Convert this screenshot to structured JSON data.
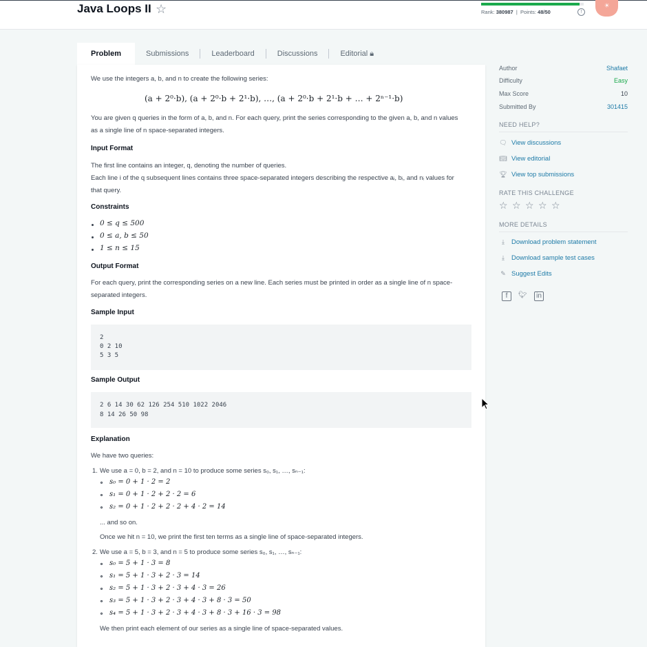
{
  "header": {
    "title": "Java Loops II",
    "rank_label": "Rank:",
    "rank_value": "380987",
    "points_label": "Points:",
    "points_value": "48/50",
    "progress": 0.96,
    "badge_text": "☀"
  },
  "tabs": [
    {
      "label": "Problem"
    },
    {
      "label": "Submissions"
    },
    {
      "label": "Leaderboard"
    },
    {
      "label": "Discussions"
    },
    {
      "label": "Editorial"
    }
  ],
  "problem": {
    "intro": "We use the integers a, b, and n to create the following series:",
    "series": "(a + 2⁰·b), (a + 2⁰·b + 2¹·b), …, (a + 2⁰·b + 2¹·b + … + 2ⁿ⁻¹·b)",
    "given_line1": "You are given q queries in the form of a, b, and n. For each query, print the series corresponding to the given a, b, and n values",
    "given_line2": "as a single line of n space-separated integers.",
    "input_format_heading": "Input Format",
    "input_line1": "The first line contains an integer, q, denoting the number of queries.",
    "input_line2": "Each line i of the q subsequent lines contains three space-separated integers describing the respective aᵢ, bᵢ, and nᵢ values for",
    "input_line3": "that query.",
    "constraints_heading": "Constraints",
    "constraints": [
      "0 ≤ q ≤ 500",
      "0 ≤ a, b ≤ 50",
      "1 ≤ n ≤ 15"
    ],
    "output_format_heading": "Output Format",
    "output_line1": "For each query, print the corresponding series on a new line. Each series must be printed in order as a single line of n space-",
    "output_line2": "separated integers.",
    "sample_input_heading": "Sample Input",
    "sample_input": [
      "2",
      "0 2 10",
      "5 3 5"
    ],
    "sample_output_heading": "Sample Output",
    "sample_output": [
      "2 6 14 30 62 126 254 510 1022 2046",
      "8 14 26 50 98"
    ],
    "explanation_heading": "Explanation",
    "explanation_intro": "We have two queries:",
    "q1_num": "1.",
    "q1_text": "We use a = 0, b = 2, and n = 10 to produce some series s₀, s₁, …, sₙ₋₁:",
    "q1_items": [
      "s₀ = 0 + 1 · 2 = 2",
      "s₁ = 0 + 1 · 2 + 2 · 2 = 6",
      "s₂ = 0 + 1 · 2 + 2 · 2 + 4 · 2 = 14"
    ],
    "q1_more": "... and so on.",
    "q1_end": "Once we hit n = 10, we print the first ten terms as a single line of space-separated integers.",
    "q2_num": "2.",
    "q2_text": "We use a = 5, b = 3, and n = 5 to produce some series s₀, s₁, …, sₙ₋₁:",
    "q2_items": [
      "s₀ = 5 + 1 · 3 = 8",
      "s₁ = 5 + 1 · 3 + 2 · 3 = 14",
      "s₂ = 5 + 1 · 3 + 2 · 3 + 4 · 3 = 26",
      "s₃ = 5 + 1 · 3 + 2 · 3 + 4 · 3 + 8 · 3 = 50",
      "s₄ = 5 + 1 · 3 + 2 · 3 + 4 · 3 + 8 · 3 + 16 · 3 = 98"
    ],
    "q2_end": "We then print each element of our series as a single line of space-separated values."
  },
  "sidebar": {
    "details": [
      {
        "label": "Author",
        "value": "Shafaet",
        "color": "#1d7aa7"
      },
      {
        "label": "Difficulty",
        "value": "Easy",
        "color": "#1ba94c"
      },
      {
        "label": "Max Score",
        "value": "10",
        "color": "#39424e"
      },
      {
        "label": "Submitted By",
        "value": "301415",
        "color": "#1d7aa7"
      }
    ],
    "need_help_heading": "NEED HELP?",
    "help_links": [
      {
        "icon": "discussions-icon",
        "label": "View discussions"
      },
      {
        "icon": "book-icon",
        "label": "View editorial"
      },
      {
        "icon": "trophy-icon",
        "label": "View top submissions"
      }
    ],
    "rate_heading": "RATE THIS CHALLENGE",
    "more_heading": "MORE DETAILS",
    "more_links": [
      {
        "icon": "download-icon",
        "label": "Download problem statement"
      },
      {
        "icon": "download-icon",
        "label": "Download sample test cases"
      },
      {
        "icon": "pencil-icon",
        "label": "Suggest Edits"
      }
    ],
    "social": [
      "facebook-icon",
      "twitter-icon",
      "linkedin-icon"
    ]
  },
  "colors": {
    "accent_green": "#1ba94c",
    "link_blue": "#1d7aa7",
    "badge": "#f4a698"
  }
}
